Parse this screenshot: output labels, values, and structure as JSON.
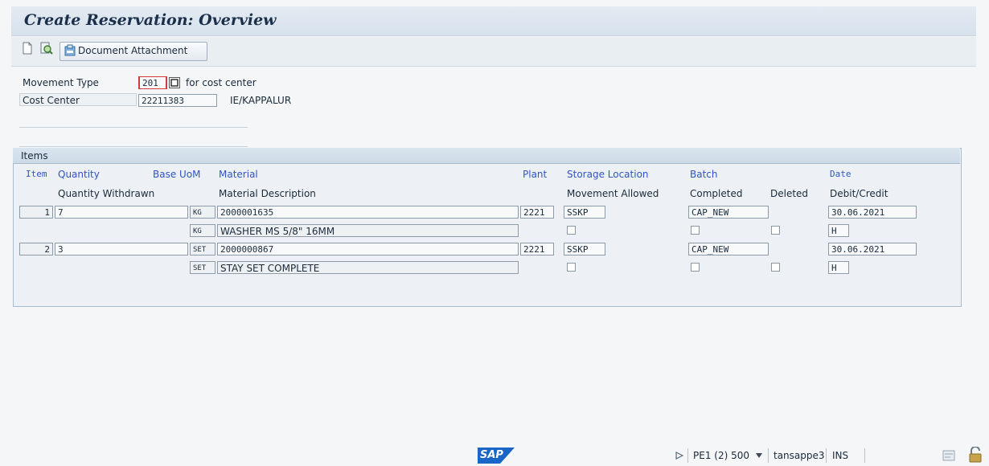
{
  "window": {
    "title": "Create Reservation: Overview"
  },
  "toolbar": {
    "document_attachment": "Document Attachment"
  },
  "header": {
    "movement_type_label": "Movement Type",
    "movement_type_value": "201",
    "movement_type_desc": "for cost center",
    "cost_center_label": "Cost Center",
    "cost_center_value": "22211383",
    "cost_center_desc": "IE/KAPPALUR"
  },
  "items": {
    "title": "Items",
    "headers": {
      "item": "Item",
      "quantity": "Quantity",
      "base_uom": "Base UoM",
      "material": "Material",
      "plant": "Plant",
      "storage_location": "Storage Location",
      "batch": "Batch",
      "date": "Date",
      "quantity_withdrawn": "Quantity Withdrawn",
      "material_description": "Material Description",
      "movement_allowed": "Movement Allowed",
      "completed": "Completed",
      "deleted": "Deleted",
      "debit_credit": "Debit/Credit"
    },
    "rows": [
      {
        "item": "1",
        "quantity": "7",
        "uom": "KG",
        "material": "2000001635",
        "plant": "2221",
        "sloc": "SSKP",
        "batch": "CAP_NEW",
        "date": "30.06.2021",
        "uom2": "KG",
        "description": "WASHER MS 5/8\" 16MM",
        "debit_credit": "H"
      },
      {
        "item": "2",
        "quantity": "3",
        "uom": "SET",
        "material": "2000000867",
        "plant": "2221",
        "sloc": "SSKP",
        "batch": "CAP_NEW",
        "date": "30.06.2021",
        "uom2": "SET",
        "description": "STAY SET COMPLETE",
        "debit_credit": "H"
      }
    ]
  },
  "footer": {
    "logo": "SAP",
    "system": "PE1 (2) 500",
    "server": "tansappe3",
    "mode": "INS"
  },
  "icons": [
    "new-document-icon",
    "find-icon",
    "document-attachment-icon",
    "f4-help-icon",
    "play-icon",
    "dropdown-icon",
    "layout-icon",
    "lock-icon"
  ],
  "colors": {
    "accent_blue": "#3054c7",
    "required_marker": "#d23b3b",
    "sap_logo": "#1a66c7"
  }
}
